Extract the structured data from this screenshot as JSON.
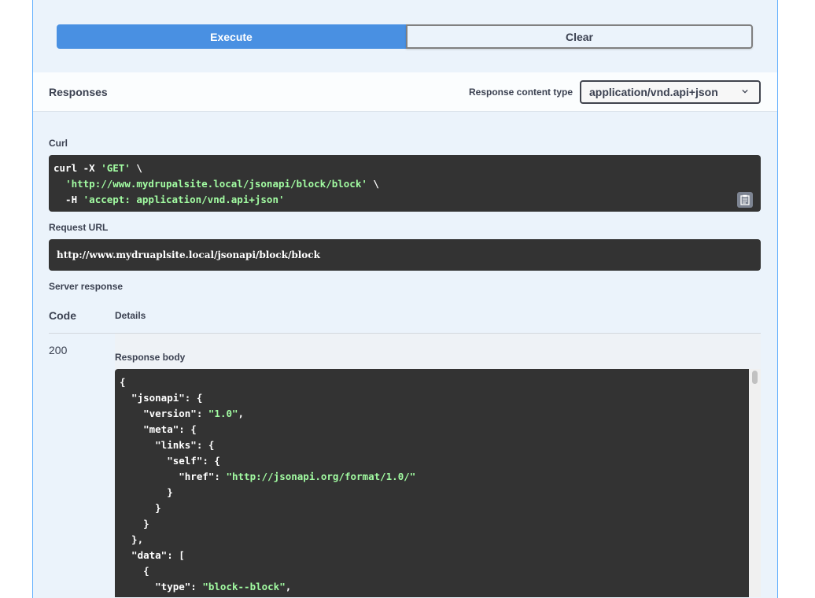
{
  "buttons": {
    "execute": "Execute",
    "clear": "Clear"
  },
  "responses": {
    "title": "Responses",
    "content_type_label": "Response content type",
    "content_type_value": "application/vnd.api+json"
  },
  "curl": {
    "label": "Curl",
    "line1_cmd": "curl -X ",
    "line1_method": "'GET'",
    "line1_tail": " \\",
    "line2_indent": "  ",
    "line2_url": "'http://www.mydrupalsite.local/jsonapi/block/block'",
    "line2_tail": " \\",
    "line3_flag": "  -H ",
    "line3_header": "'accept: application/vnd.api+json'"
  },
  "request_url": {
    "label": "Request URL",
    "value": "http://www.mydruaplsite.local/jsonapi/block/block"
  },
  "server_response": {
    "label": "Server response",
    "col_code": "Code",
    "col_details": "Details",
    "code": "200",
    "body_label": "Response body",
    "body_lines": [
      {
        "k": "{",
        "s": "",
        "e": ""
      },
      {
        "k": "  \"jsonapi\": {",
        "s": "",
        "e": ""
      },
      {
        "k": "    \"version\": ",
        "s": "\"1.0\"",
        "e": ","
      },
      {
        "k": "    \"meta\": {",
        "s": "",
        "e": ""
      },
      {
        "k": "      \"links\": {",
        "s": "",
        "e": ""
      },
      {
        "k": "        \"self\": {",
        "s": "",
        "e": ""
      },
      {
        "k": "          \"href\": ",
        "s": "\"http://jsonapi.org/format/1.0/\"",
        "e": ""
      },
      {
        "k": "        }",
        "s": "",
        "e": ""
      },
      {
        "k": "      }",
        "s": "",
        "e": ""
      },
      {
        "k": "    }",
        "s": "",
        "e": ""
      },
      {
        "k": "  },",
        "s": "",
        "e": ""
      },
      {
        "k": "  \"data\": [",
        "s": "",
        "e": ""
      },
      {
        "k": "    {",
        "s": "",
        "e": ""
      },
      {
        "k": "      \"type\": ",
        "s": "\"block--block\"",
        "e": ","
      }
    ]
  },
  "icons": {
    "copy": "clipboard-icon",
    "dropdown": "chevron-down-icon"
  },
  "colors": {
    "execute_bg": "#4990e2",
    "panel_bg": "#ebf3fb",
    "code_bg": "#333333",
    "string": "#a2fca2"
  }
}
